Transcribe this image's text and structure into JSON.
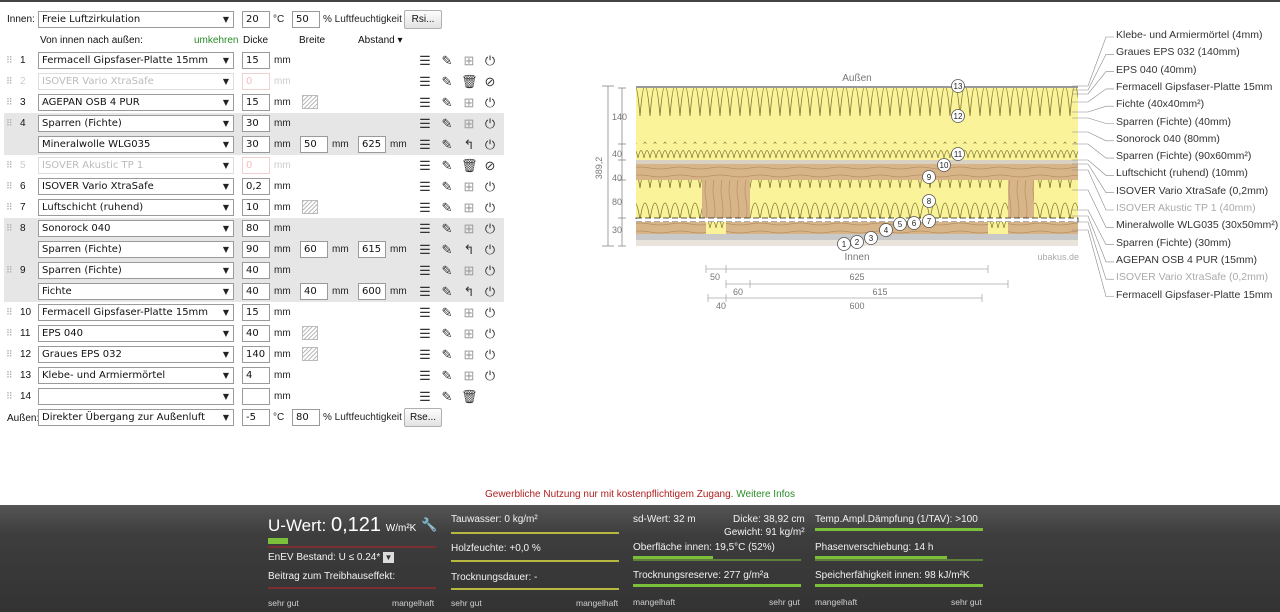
{
  "inner": {
    "label": "Innen:",
    "select": "Freie Luftzirkulation",
    "temp": "20",
    "temp_unit": "°C",
    "humidity": "50",
    "humidity_unit": "% Luftfeuchtigkeit",
    "btn": "Rsi..."
  },
  "header": {
    "direction": "Von innen nach außen:",
    "reverse": "umkehren",
    "col_thickness": "Dicke",
    "col_width": "Breite",
    "col_distance": "Abstand ▾"
  },
  "layers": [
    {
      "num": "1",
      "material": "Fermacell Gipsfaser-Platte 15mm",
      "thickness": "15",
      "unit": "mm",
      "active": true,
      "hatch": false
    },
    {
      "num": "2",
      "material": "ISOVER Vario XtraSafe",
      "thickness": "0",
      "unit": "mm",
      "active": false,
      "hatch": false
    },
    {
      "num": "3",
      "material": "AGEPAN OSB 4 PUR",
      "thickness": "15",
      "unit": "mm",
      "active": true,
      "hatch": true
    },
    {
      "num": "4",
      "material": "Sparren (Fichte)",
      "thickness": "30",
      "unit": "mm",
      "active": true,
      "hatch": false,
      "sub": {
        "material": "Mineralwolle WLG035",
        "thickness": "30",
        "width": "50",
        "distance": "625"
      }
    },
    {
      "num": "5",
      "material": "ISOVER Akustic TP 1",
      "thickness": "0",
      "unit": "mm",
      "active": false,
      "hatch": false
    },
    {
      "num": "6",
      "material": "ISOVER Vario XtraSafe",
      "thickness": "0,2",
      "unit": "mm",
      "active": true,
      "hatch": false
    },
    {
      "num": "7",
      "material": "Luftschicht (ruhend)",
      "thickness": "10",
      "unit": "mm",
      "active": true,
      "hatch": true
    },
    {
      "num": "8",
      "material": "Sonorock 040",
      "thickness": "80",
      "unit": "mm",
      "active": true,
      "hatch": false,
      "sub": {
        "material": "Sparren (Fichte)",
        "thickness": "90",
        "width": "60",
        "distance": "615"
      }
    },
    {
      "num": "9",
      "material": "Sparren (Fichte)",
      "thickness": "40",
      "unit": "mm",
      "active": true,
      "hatch": false,
      "sub": {
        "material": "Fichte",
        "thickness": "40",
        "width": "40",
        "distance": "600"
      }
    },
    {
      "num": "10",
      "material": "Fermacell Gipsfaser-Platte 15mm",
      "thickness": "15",
      "unit": "mm",
      "active": true,
      "hatch": false
    },
    {
      "num": "11",
      "material": "EPS 040",
      "thickness": "40",
      "unit": "mm",
      "active": true,
      "hatch": true
    },
    {
      "num": "12",
      "material": "Graues EPS  032",
      "thickness": "140",
      "unit": "mm",
      "active": true,
      "hatch": true
    },
    {
      "num": "13",
      "material": "Klebe- und Armiermörtel",
      "thickness": "4",
      "unit": "mm",
      "active": true,
      "hatch": false
    },
    {
      "num": "14",
      "material": "",
      "thickness": "",
      "unit": "mm",
      "active": true,
      "hatch": false,
      "empty": true
    }
  ],
  "outer": {
    "label": "Außen:",
    "select": "Direkter Übergang zur Außenluft",
    "temp": "-5",
    "temp_unit": "°C",
    "humidity": "80",
    "humidity_unit": "% Luftfeuchtigkeit",
    "btn": "Rse..."
  },
  "diagram": {
    "label_outside": "Außen",
    "label_inside": "Innen",
    "watermark": "ubakus.de",
    "total": "389,2",
    "dims_left": [
      "140",
      "40",
      "40",
      "80",
      "30"
    ],
    "dims_bottom": [
      "50",
      "625",
      "60",
      "615",
      "40",
      "600"
    ],
    "markers": [
      "1",
      "2",
      "3",
      "4",
      "5",
      "6",
      "7",
      "8",
      "9",
      "10",
      "11",
      "12",
      "13"
    ]
  },
  "legend": [
    {
      "text": "Klebe- und Armiermörtel (4mm)",
      "dim": false
    },
    {
      "text": "Graues EPS  032 (140mm)",
      "dim": false
    },
    {
      "text": "EPS 040 (40mm)",
      "dim": false
    },
    {
      "text": "Fermacell Gipsfaser-Platte 15mm",
      "dim": false
    },
    {
      "text": "Fichte (40x40mm²)",
      "dim": false
    },
    {
      "text": "Sparren (Fichte) (40mm)",
      "dim": false
    },
    {
      "text": "Sonorock 040 (80mm)",
      "dim": false
    },
    {
      "text": "Sparren (Fichte) (90x60mm²)",
      "dim": false
    },
    {
      "text": "Luftschicht (ruhend) (10mm)",
      "dim": false
    },
    {
      "text": "ISOVER Vario XtraSafe (0,2mm)",
      "dim": false
    },
    {
      "text": "ISOVER Akustic TP 1 (40mm)",
      "dim": true
    },
    {
      "text": "Mineralwolle WLG035 (30x50mm²)",
      "dim": false
    },
    {
      "text": "Sparren (Fichte) (30mm)",
      "dim": false
    },
    {
      "text": "AGEPAN OSB 4 PUR (15mm)",
      "dim": false
    },
    {
      "text": "ISOVER Vario XtraSafe (0,2mm)",
      "dim": true
    },
    {
      "text": "Fermacell Gipsfaser-Platte 15mm",
      "dim": false
    }
  ],
  "notice": {
    "text": "Gewerbliche Nutzung nur mit kostenpflichtigem Zugang.",
    "link": "Weitere Infos"
  },
  "results": {
    "u_label": "U-Wert:",
    "u_value": "0,121",
    "u_unit": "W/m²K",
    "u_fill": 0.12,
    "enev": "EnEV Bestand: U ≤ 0.24*",
    "greenhouse": "Beitrag zum Treibhauseffekt:",
    "scale_good": "sehr gut",
    "scale_bad": "mangelhaft",
    "tauwasser": "Tauwasser: 0 kg/m²",
    "holzfeuchte": "Holzfeuchte: +0,0 %",
    "trocknungsdauer": "Trocknungsdauer: -",
    "sd": "sd-Wert: 32 m",
    "dicke": "Dicke: 38,92 cm",
    "gewicht": "Gewicht: 91 kg/m²",
    "oberflaeche": "Oberfläche innen: 19,5°C (52%)",
    "trocknungsreserve": "Trocknungsreserve: 277 g/m²a",
    "temp_ampl": "Temp.Ampl.Dämpfung (1/TAV): >100",
    "phasen": "Phasenverschiebung: 14 h",
    "speicher": "Speicherfähigkeit innen: 98 kJ/m²K",
    "colors": {
      "good": "#7bbf3a",
      "bad": "#8a3030",
      "mid": "#d9d944"
    }
  }
}
